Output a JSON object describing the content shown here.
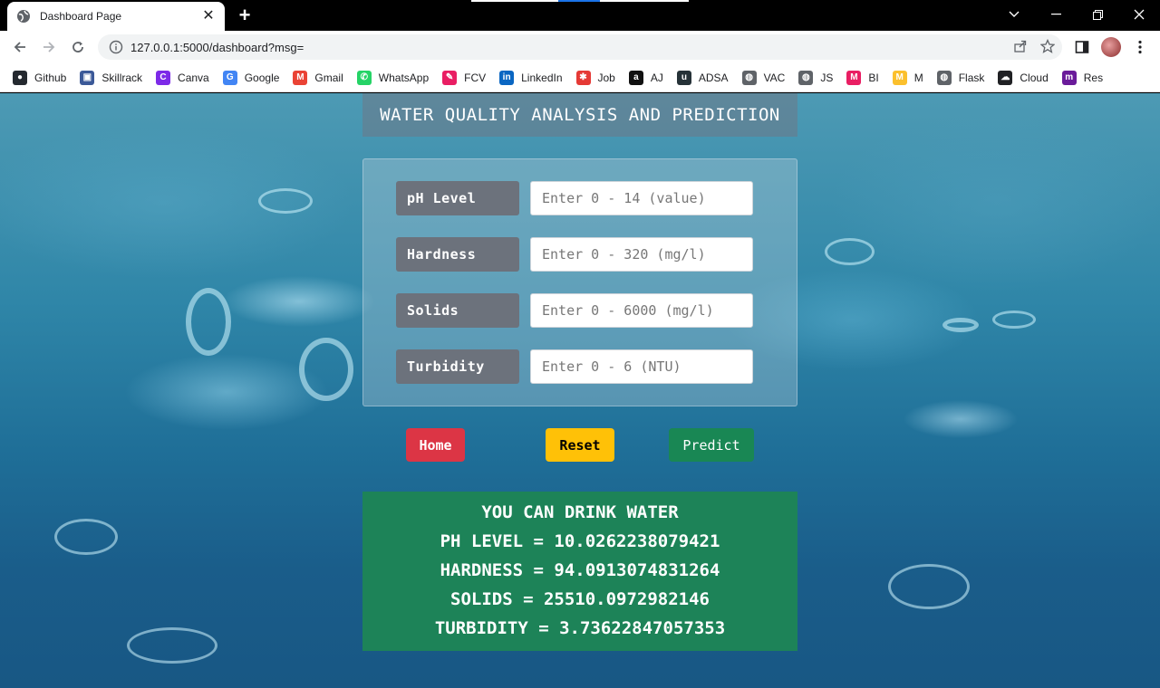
{
  "browser": {
    "tab_title": "Dashboard Page",
    "url": "127.0.0.1:5000/dashboard?msg=",
    "bookmarks": [
      {
        "label": "Github",
        "icon": "github-icon",
        "color": "#24292f"
      },
      {
        "label": "Skillrack",
        "icon": "skillrack-icon",
        "color": "#3b5998"
      },
      {
        "label": "Canva",
        "icon": "canva-icon",
        "color": "#7d2ae8"
      },
      {
        "label": "Google",
        "icon": "google-icon",
        "color": "#4285f4"
      },
      {
        "label": "Gmail",
        "icon": "gmail-icon",
        "color": "#ea4335"
      },
      {
        "label": "WhatsApp",
        "icon": "whatsapp-icon",
        "color": "#25d366"
      },
      {
        "label": "FCV",
        "icon": "fcv-icon",
        "color": "#e91e63"
      },
      {
        "label": "LinkedIn",
        "icon": "linkedin-icon",
        "color": "#0a66c2"
      },
      {
        "label": "Job",
        "icon": "job-icon",
        "color": "#e53935"
      },
      {
        "label": "AJ",
        "icon": "amazon-icon",
        "color": "#111111"
      },
      {
        "label": "ADSA",
        "icon": "adsa-icon",
        "color": "#263238"
      },
      {
        "label": "VAC",
        "icon": "globe-icon",
        "color": "#5f6368"
      },
      {
        "label": "JS",
        "icon": "globe-icon",
        "color": "#5f6368"
      },
      {
        "label": "BI",
        "icon": "bi-icon",
        "color": "#e91e63"
      },
      {
        "label": "M",
        "icon": "m-icon",
        "color": "#fbc02d"
      },
      {
        "label": "Flask",
        "icon": "globe-icon",
        "color": "#5f6368"
      },
      {
        "label": "Cloud",
        "icon": "cloud-icon",
        "color": "#202124"
      },
      {
        "label": "Res",
        "icon": "res-icon",
        "color": "#6a1b9a"
      }
    ]
  },
  "page": {
    "title": "WATER QUALITY ANALYSIS AND PREDICTION",
    "fields": [
      {
        "label": "pH Level",
        "placeholder": "Enter 0 - 14 (value)",
        "value": ""
      },
      {
        "label": "Hardness",
        "placeholder": "Enter 0 - 320 (mg/l)",
        "value": ""
      },
      {
        "label": "Solids",
        "placeholder": "Enter 0 - 6000 (mg/l)",
        "value": ""
      },
      {
        "label": "Turbidity",
        "placeholder": "Enter 0 - 6 (NTU)",
        "value": ""
      }
    ],
    "buttons": {
      "home": "Home",
      "reset": "Reset",
      "predict": "Predict"
    },
    "result": {
      "verdict": "YOU CAN DRINK WATER",
      "ph": "PH LEVEL = 10.0262238079421",
      "hardness": "HARDNESS = 94.0913074831264",
      "solids": "SOLIDS = 25510.0972982146",
      "turbidity": "TURBIDITY = 3.73622847057353"
    },
    "colors": {
      "home_button": "#dc3545",
      "reset_button": "#ffc107",
      "predict_button": "#198754",
      "result_background": "#1d8358"
    }
  }
}
